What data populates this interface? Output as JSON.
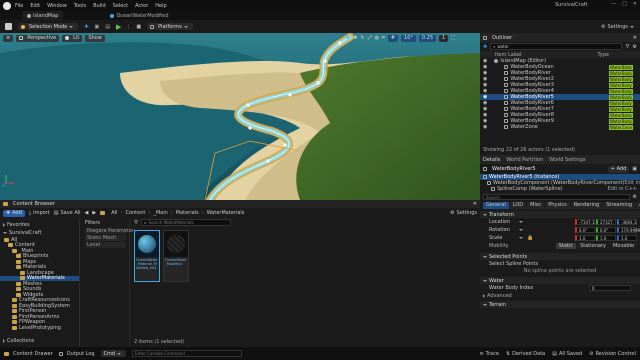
{
  "app": {
    "title": "SurvivalCraft",
    "menu": [
      "File",
      "Edit",
      "Window",
      "Tools",
      "Build",
      "Select",
      "Actor",
      "Help"
    ]
  },
  "tabs": {
    "level": "IslandMap",
    "doc": "OceanWaterModified"
  },
  "toolbar": {
    "mode": "Selection Mode",
    "platforms": "Platforms",
    "settings": "Settings"
  },
  "viewport": {
    "perspective": "Perspective",
    "lit": "Lit",
    "show": "Show",
    "snap_angle": "10°",
    "snap_scale": "0.25",
    "cam_speed": "1"
  },
  "outliner": {
    "title": "Outliner",
    "search": "water",
    "col_label": "Item Label",
    "col_type": "Type",
    "items": [
      {
        "label": "IslandMap (Editor)",
        "type": ""
      },
      {
        "label": "WaterBodyOcean",
        "type": "WaterBody"
      },
      {
        "label": "WaterBodyRiver",
        "type": "WaterBody"
      },
      {
        "label": "WaterBodyRiver2",
        "type": "WaterBody"
      },
      {
        "label": "WaterBodyRiver3",
        "type": "WaterBody"
      },
      {
        "label": "WaterBodyRiver4",
        "type": "WaterBody"
      },
      {
        "label": "WaterBodyRiver5",
        "type": "WaterBody"
      },
      {
        "label": "WaterBodyRiver6",
        "type": "WaterBody"
      },
      {
        "label": "WaterBodyRiver7",
        "type": "WaterBody"
      },
      {
        "label": "WaterBodyRiver8",
        "type": "WaterBody"
      },
      {
        "label": "WaterBodyRiver9",
        "type": "WaterBody"
      },
      {
        "label": "WaterZone",
        "type": "WaterZone"
      }
    ],
    "footer": "Showing 22 of 26 actors (1 selected)"
  },
  "details": {
    "tab_details": "Details",
    "tab_partition": "World Partition",
    "tab_settings": "World Settings",
    "actor": "WaterBodyRiver5",
    "add": "+ Add",
    "components": [
      {
        "label": "WaterBodyRiver5 (Instance)",
        "edit": ""
      },
      {
        "label": "WaterBodyComponent (WaterBodyRiverComponent)",
        "edit": "Edit in C++"
      },
      {
        "label": "SplineComp (WaterSpline)",
        "edit": "Edit in C++"
      }
    ],
    "search": "Search",
    "filters": [
      "General",
      "LOD",
      "Misc",
      "Physics",
      "Rendering",
      "Streaming",
      "All"
    ],
    "transform": "Transform",
    "location": {
      "label": "Location",
      "x": "-7347.1",
      "y": "27327.",
      "z": "-3664.1"
    },
    "rotation": {
      "label": "Rotation",
      "x": "0.0°",
      "y": "0.0°",
      "z": "179.9999°"
    },
    "scale": {
      "label": "Scale",
      "x": "1.0",
      "y": "1.0",
      "z": "1.0"
    },
    "mobility": {
      "label": "Mobility",
      "options": [
        "Static",
        "Stationary",
        "Movable"
      ]
    },
    "selected_points": "Selected Points",
    "select_points": "Select Spline Points",
    "no_points": "No spline points are selected",
    "water": "Water",
    "water_index": "Water Body Index",
    "water_index_value": "0",
    "advanced": "Advanced",
    "terrain": "Terrain"
  },
  "content_browser": {
    "title": "Content Browser",
    "add": "Add",
    "import": "Import",
    "save_all": "Save All",
    "path": [
      "All",
      "Content",
      "_Main",
      "Materials",
      "WaterMaterials"
    ],
    "settings": "Settings",
    "favorites": "Favorites",
    "project": "SurvivalCraft",
    "tree": [
      "All",
      "Content",
      "_Main",
      "Blueprints",
      "Maps",
      "Materials",
      "Landscape",
      "WaterMaterials",
      "Meshes",
      "Sounds",
      "Widgets",
      "CraftResourcesIcons",
      "EasyBuildingSystem",
      "FirstPerson",
      "FirstPersonArms",
      "FPWeapon",
      "LevelPrototyping"
    ],
    "collections": "Collections",
    "filters": "Filters",
    "filter_items": [
      "Niagara Parameter",
      "Static Mesh",
      "Level"
    ],
    "search": "Search WaterMaterials",
    "assets": [
      {
        "name": "OceanWater_Material_Modified_Inst"
      },
      {
        "name": "OceanWater_Modified"
      }
    ],
    "footer": "2 items (1 selected)"
  },
  "statusbar": {
    "content_drawer": "Content Drawer",
    "output_log": "Output Log",
    "cmd": "Cmd",
    "console": "Enter Console Command",
    "trace": "Trace",
    "derived": "Derived Data",
    "saved": "All Saved",
    "revision": "Revision Control"
  }
}
